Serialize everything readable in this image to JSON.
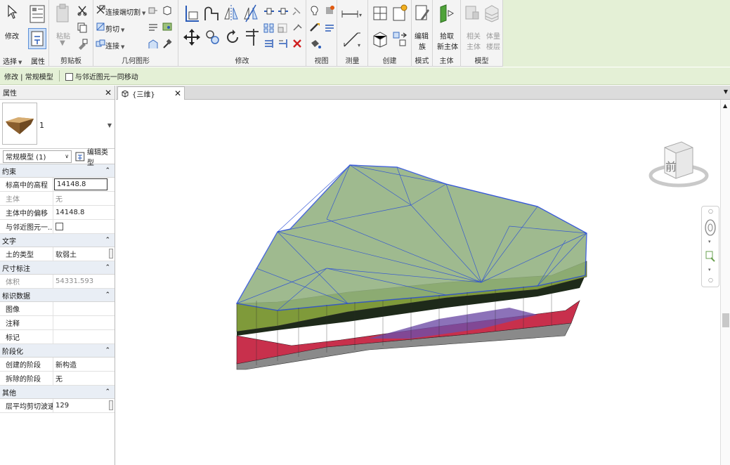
{
  "ribbon": {
    "modify_label": "修改",
    "select_label": "选择",
    "properties_label": "属性",
    "clipboard": {
      "group": "剪贴板",
      "paste": "粘贴"
    },
    "geometry": {
      "group": "几何图形",
      "join_cut": "连接端切割",
      "cut": "剪切",
      "join": "连接"
    },
    "modify_group": "修改",
    "view_group": "视图",
    "measure_group": "测量",
    "create_group": "创建",
    "mode": {
      "group": "模式",
      "edit_family_1": "编辑",
      "edit_family_2": "族"
    },
    "host": {
      "group": "主体",
      "pick_1": "拾取",
      "pick_2": "新主体"
    },
    "model": {
      "group": "模型",
      "related_1": "相关",
      "related_2": "主体",
      "mass_1": "体量",
      "mass_2": "楼层"
    }
  },
  "options_bar": {
    "context": "修改 | 常规模型",
    "move_with": "与邻近图元一同移动"
  },
  "properties": {
    "title": "属性",
    "type_count": "1",
    "selector": "常规模型 (1)",
    "edit_type": "编辑类型",
    "sections": {
      "constraints": "约束",
      "text": "文字",
      "dimensions": "尺寸标注",
      "identity": "标识数据",
      "phasing": "阶段化",
      "other": "其他"
    },
    "rows": {
      "elevation_name": "标高中的高程",
      "elevation_value": "14148.8",
      "host_name": "主体",
      "host_value": "无",
      "offset_name": "主体中的偏移",
      "offset_value": "14148.8",
      "move_name": "与邻近图元一...",
      "soil_name": "土的类型",
      "soil_value": "软弱土",
      "volume_name": "体积",
      "volume_value": "54331.593",
      "image_name": "图像",
      "comments_name": "注释",
      "mark_name": "标记",
      "phase_created_name": "创建的阶段",
      "phase_created_value": "新构造",
      "phase_demolished_name": "拆除的阶段",
      "phase_demolished_value": "无",
      "shear_name": "层平均剪切波速",
      "shear_value": "129"
    }
  },
  "view": {
    "tab_title": "{三维}",
    "viewcube_face": "前"
  },
  "colors": {
    "ribbon_context": "#e4f0d6",
    "edge_blue": "#2b4fd6",
    "soil_green": "#8fae7c",
    "layer_red": "#c8304c",
    "layer_gray": "#8a8a8a"
  }
}
